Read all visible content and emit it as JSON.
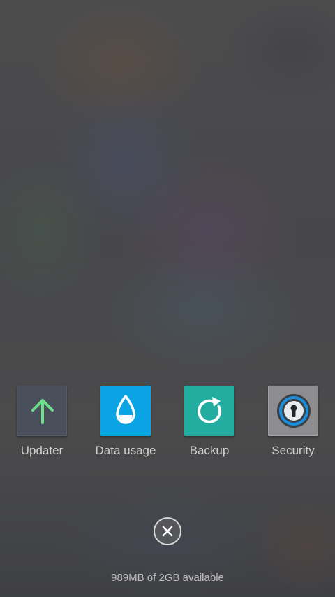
{
  "shortcuts": [
    {
      "label": "Updater",
      "icon": "arrow-up-icon",
      "tile_color": "#4a4f5c",
      "icon_color": "#6fe08a"
    },
    {
      "label": "Data usage",
      "icon": "water-drop-icon",
      "tile_color": "#0aa4e4",
      "icon_color": "#ffffff"
    },
    {
      "label": "Backup",
      "icon": "refresh-icon",
      "tile_color": "#22ada0",
      "icon_color": "#ffffff"
    },
    {
      "label": "Security",
      "icon": "keyhole-icon",
      "tile_color": "#8d8d8f",
      "icon_color": "#1a8fe0"
    }
  ],
  "close": {
    "icon": "close-icon"
  },
  "memory": {
    "text": "989MB of 2GB available"
  }
}
